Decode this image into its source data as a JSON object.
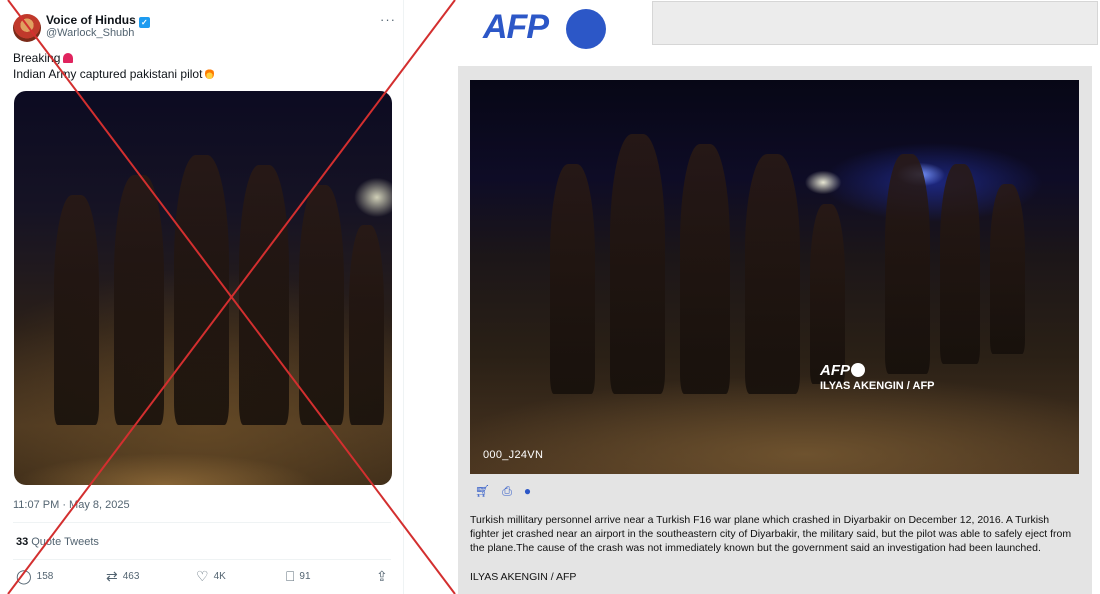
{
  "tweet": {
    "display_name": "Voice of Hindus",
    "handle": "@Warlock_Shubh",
    "more": "···",
    "text_line1": "Breaking",
    "text_line2": "Indian Army captured pakistani pilot",
    "timestamp": "11:07 PM · May 8, 2025",
    "quote_count": "33",
    "quote_label": "Quote Tweets",
    "replies": "158",
    "retweets": "463",
    "likes": "4K",
    "bookmarks": "91",
    "icons": [
      "avatar",
      "verified-badge-icon",
      "siren-emoji",
      "fire-emoji",
      "reply-icon",
      "retweet-icon",
      "like-icon",
      "bookmark-icon",
      "share-icon"
    ]
  },
  "overlay": {
    "cross_color": "#d32f2f"
  },
  "afp": {
    "logo_text": "AFP",
    "brand_color": "#2c57c7",
    "watermark_logo": "AFP",
    "watermark_credit": "ILYAS AKENGIN / AFP",
    "photo_code": "000_J24VN",
    "action_icons": [
      "cart-icon",
      "print-icon",
      "globe-icon"
    ],
    "caption": "Turkish millitary personnel arrive near a Turkish F16 war plane which crashed in Diyarbakir on December 12, 2016. A Turkish fighter jet crashed near an airport in the southeastern city of Diyarbakir, the military said, but the pilot was able to safely eject from the plane.The cause of the crash was not immediately known but the government said an investigation had been launched.",
    "credit": "ILYAS AKENGIN / AFP"
  }
}
